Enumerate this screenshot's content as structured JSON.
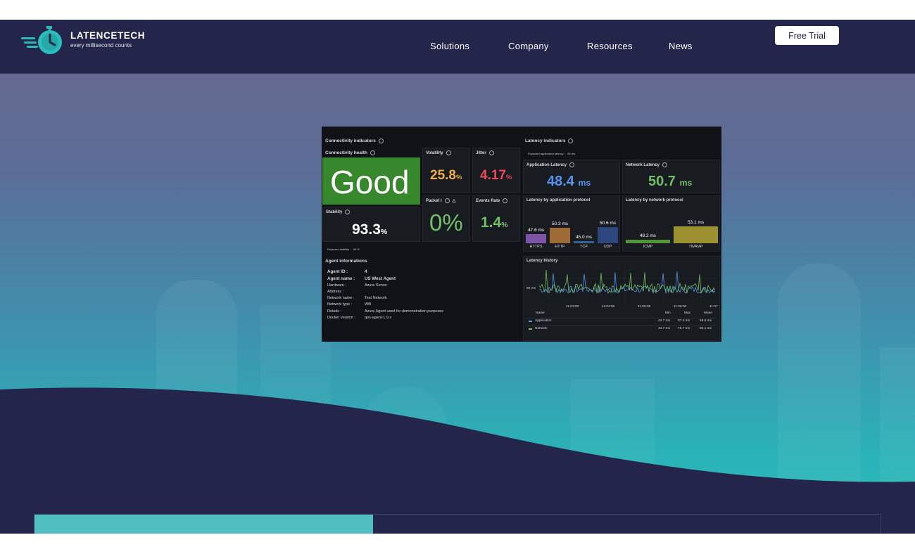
{
  "header": {
    "brand": "LATENCETECH",
    "tagline": "every millisecond counts",
    "nav": [
      "Solutions",
      "Company",
      "Resources",
      "News"
    ],
    "cta": "Free Trial"
  },
  "dashboard": {
    "connectivity": {
      "section_title": "Connectivity indicators",
      "health_title": "Connectivity health",
      "health_value": "Good",
      "volatility_title": "Volatility",
      "volatility_value": "25.8",
      "volatility_unit": "%",
      "jitter_title": "Jitter",
      "jitter_value": "4.17",
      "jitter_unit": "%",
      "stability_title": "Stability",
      "stability_value": "93.3",
      "stability_unit": "%",
      "packet_title": "Packet l",
      "packet_value": "0%",
      "events_title": "Events Rate",
      "events_value": "1.4",
      "events_unit": "%",
      "expected_stability_label": "Expected stability :",
      "expected_stability_value": "60 %"
    },
    "latency": {
      "section_title": "Latency indicators",
      "expected_label": "Expected application latency :",
      "expected_value": "60 ms",
      "app_title": "Application Latency",
      "app_value": "48.4",
      "app_unit": "ms",
      "net_title": "Network Latency",
      "net_value": "50.7",
      "net_unit": "ms",
      "by_app_title": "Latency by application protocol",
      "by_net_title": "Latency by network protocol",
      "history_title": "Latency history"
    },
    "protocol_bars": {
      "app": [
        {
          "label": "HTTPS",
          "display": "47.6 ms",
          "value": 47.6,
          "color": "#8f5fc0"
        },
        {
          "label": "HTTP",
          "display": "50.3 ms",
          "value": 50.3,
          "color": "#b6783a"
        },
        {
          "label": "TCP",
          "display": "45.0 ms",
          "value": 45.0,
          "color": "#3b6fa8"
        },
        {
          "label": "UDP",
          "display": "50.6 ms",
          "value": 50.6,
          "color": "#2f4f8f"
        }
      ],
      "net": [
        {
          "label": "ICMP",
          "display": "48.2 ms",
          "value": 48.2,
          "color": "#5fa842"
        },
        {
          "label": "TWAMP",
          "display": "53.1 ms",
          "value": 53.1,
          "color": "#b5a534"
        }
      ]
    },
    "history": {
      "y_label": "60 ms",
      "x_ticks": [
        "11:03:00",
        "11:04:00",
        "11:05:00",
        "11:06:00",
        "11:07"
      ],
      "legend_header": {
        "name": "Name",
        "min": "Min",
        "max": "Max",
        "mean": "Mean"
      },
      "legend": [
        {
          "name": "Application",
          "min": "44.7 ms",
          "max": "57.4 ms",
          "mean": "48.5 ms",
          "color": "#5794f2"
        },
        {
          "name": "Network",
          "min": "44.7 ms",
          "max": "75.7 ms",
          "mean": "50.1 ms",
          "color": "#73bf69"
        }
      ]
    },
    "agent": {
      "section_title": "Agent informations",
      "rows": [
        {
          "key": "Agent ID :",
          "value": "4"
        },
        {
          "key": "Agent name :",
          "value": "US West Agent"
        },
        {
          "key": "Hardware :",
          "value": "Azure Server"
        },
        {
          "key": "Address :",
          "value": ""
        },
        {
          "key": "Network name :",
          "value": "Test Network"
        },
        {
          "key": "Network type :",
          "value": "Wifi"
        },
        {
          "key": "Details :",
          "value": "Azure Agent used for demonstration purposes"
        },
        {
          "key": "Docker version :",
          "value": "qos-agent-1.9.x"
        }
      ]
    }
  },
  "colors": {
    "navy": "#24254a",
    "teal": "#2cbcbb",
    "good": "#37872d",
    "orange": "#f2ac4a",
    "red": "#f2495c",
    "green": "#73bf69",
    "blue": "#5794f2"
  }
}
